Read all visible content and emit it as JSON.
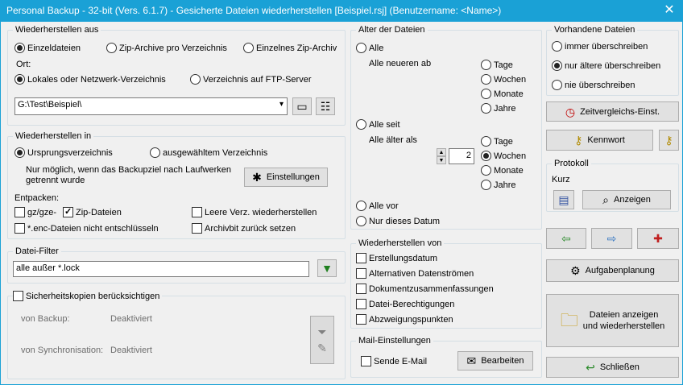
{
  "window": {
    "title": "Personal Backup - 32-bit (Vers. 6.1.7) - Gesicherte Dateien wiederherstellen [Beispiel.rsj] (Benutzername: <Name>)",
    "close_glyph": "✕"
  },
  "restore_from": {
    "legend": "Wiederherstellen aus",
    "opt_single": "Einzeldateien",
    "opt_zip_per_dir": "Zip-Archive pro Verzeichnis",
    "opt_single_zip": "Einzelnes Zip-Archiv",
    "location_label": "Ort:",
    "opt_local": "Lokales oder Netzwerk-Verzeichnis",
    "opt_ftp": "Verzeichnis auf FTP-Server",
    "path_value": "G:\\Test\\Beispiel\\"
  },
  "restore_to": {
    "legend": "Wiederherstellen in",
    "opt_origin": "Ursprungsverzeichnis",
    "opt_selected": "ausgewähltem Verzeichnis",
    "note": "Nur möglich, wenn das Backupziel nach Laufwerken getrennt wurde",
    "settings_button": "Einstellungen",
    "unpack_label": "Entpacken:",
    "chk_gz": "gz/gze-",
    "chk_zip": "Zip-Dateien",
    "chk_empty_dirs": "Leere Verz. wiederherstellen",
    "chk_enc": "*.enc-Dateien nicht entschlüsseln",
    "chk_archivebit": "Archivbit zurück setzen"
  },
  "file_filter": {
    "legend": "Datei-Filter",
    "value": "alle außer *.lock"
  },
  "backup_copies": {
    "label": "Sicherheitskopien berücksichtigen",
    "from_backup_label": "von Backup:",
    "from_backup_value": "Deaktiviert",
    "from_sync_label": "von Synchronisation:",
    "from_sync_value": "Deaktiviert"
  },
  "file_age": {
    "legend": "Alter der Dateien",
    "opt_all": "Alle",
    "newer_label": "Alle neueren ab",
    "unit_days": "Tage",
    "unit_weeks": "Wochen",
    "unit_months": "Monate",
    "unit_years": "Jahre",
    "opt_since": "Alle seit",
    "older_label": "Alle älter als",
    "older_value": "2",
    "opt_before": "Alle vor",
    "opt_date_only": "Nur dieses Datum"
  },
  "restore_of": {
    "legend": "Wiederherstellen von",
    "items": [
      "Erstellungsdatum",
      "Alternativen Datenströmen",
      "Dokumentzusammenfassungen",
      "Datei-Berechtigungen",
      "Abzweigungspunkten"
    ]
  },
  "mail": {
    "legend": "Mail-Einstellungen",
    "send_label": "Sende E-Mail",
    "edit_button": "Bearbeiten"
  },
  "existing": {
    "legend": "Vorhandene Dateien",
    "opt_always": "immer überschreiben",
    "opt_older": "nur ältere überschreiben",
    "opt_never": "nie überschreiben"
  },
  "right": {
    "time_compare_button": "Zeitvergleichs-Einst.",
    "password_button": "Kennwort",
    "protocol_legend": "Protokoll",
    "protocol_mode": "Kurz",
    "show_button": "Anzeigen",
    "task_button": "Aufgabenplanung",
    "show_restore_button_line1": "Dateien anzeigen",
    "show_restore_button_line2": "und wiederherstellen",
    "close_button": "Schließen"
  }
}
